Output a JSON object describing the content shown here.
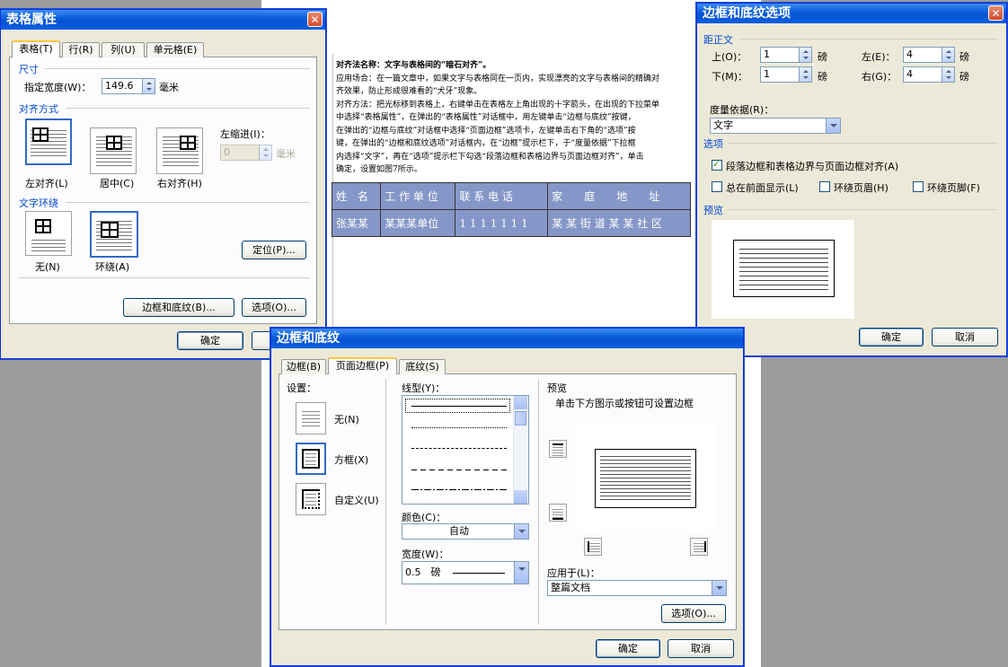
{
  "doc": {
    "heading": "对齐法名称：文字与表格间的“暗石对齐”。",
    "lines": [
      "应用场合：在一篇文章中，如果文字与表格同在一页内，实现漂亮的文字与表格间的精确对",
      "齐效果，防止形成很难看的“犬牙”现象。",
      "对齐方法：把光标移到表格上，右键单击在表格左上角出现的十字箭头，在出现的下拉菜单",
      "中选择“表格属性”，在弹出的“表格属性”对话框中，用左键单击“边框与底纹”按键，",
      "在弹出的“边框与底纹”对话框中选择“页面边框”选项卡，左键单击右下角的“选项”按",
      "键，在弹出的“边框和底纹选项”对话框内，在“边框”提示栏下，于“度量依据”下拉框",
      "内选择“文字”，再在“选项”提示栏下勾选“段落边框和表格边界与页面边框对齐”，单击",
      "确定，设置如图7所示。"
    ],
    "table": [
      [
        "姓　名",
        "工 作 单 位",
        "联 系 电 话",
        "家　　庭　　地　　址"
      ],
      [
        "张某某",
        "某某某单位",
        "1 1 1 1 1 1 1",
        "某 某 街 道 某 某 社 区"
      ]
    ]
  },
  "table_props": {
    "title": "表格属性",
    "close": "✕",
    "tabs": [
      "表格(T)",
      "行(R)",
      "列(U)",
      "单元格(E)"
    ],
    "size_label": "尺寸",
    "width_label": "指定宽度(W)：",
    "width_value": "149.6",
    "width_unit": "毫米",
    "align_label": "对齐方式",
    "align_left": "左对齐(L)",
    "align_center": "居中(C)",
    "align_right": "右对齐(H)",
    "indent_label": "左缩进(I)：",
    "indent_value": "0",
    "indent_unit": "毫米",
    "wrap_label": "文字环绕",
    "wrap_none": "无(N)",
    "wrap_around": "环绕(A)",
    "position_btn": "定位(P)...",
    "borders_btn": "边框和底纹(B)...",
    "options_btn": "选项(O)...",
    "ok": "确定"
  },
  "border_options": {
    "title": "边框和底纹选项",
    "close": "✕",
    "from_text": "距正文",
    "top_label": "上(O)：",
    "top_value": "1",
    "bottom_label": "下(M)：",
    "bottom_value": "1",
    "left_label": "左(E)：",
    "left_value": "4",
    "right_label": "右(G)：",
    "right_value": "4",
    "unit": "磅",
    "measure_label": "度量依据(R)：",
    "measure_value": "文字",
    "options_label": "选项",
    "opt_align": "段落边框和表格边界与页面边框对齐(A)",
    "opt_front": "总在前面显示(L)",
    "opt_header": "环绕页眉(H)",
    "opt_footer": "环绕页脚(F)",
    "preview_label": "预览",
    "ok": "确定",
    "cancel": "取消"
  },
  "borders_shading": {
    "title": "边框和底纹",
    "tabs": [
      "边框(B)",
      "页面边框(P)",
      "底纹(S)"
    ],
    "setting_label": "设置：",
    "set_none": "无(N)",
    "set_box": "方框(X)",
    "set_custom": "自定义(U)",
    "style_label": "线型(Y)：",
    "color_label": "颜色(C)：",
    "color_value": "自动",
    "width_label": "宽度(W)：",
    "width_value": "0.5　磅",
    "preview_label": "预览",
    "preview_hint": "单击下方图示或按钮可设置边框",
    "apply_label": "应用于(L)：",
    "apply_value": "整篇文档",
    "options_btn": "选项(O)...",
    "ok": "确定",
    "cancel": "取消"
  }
}
